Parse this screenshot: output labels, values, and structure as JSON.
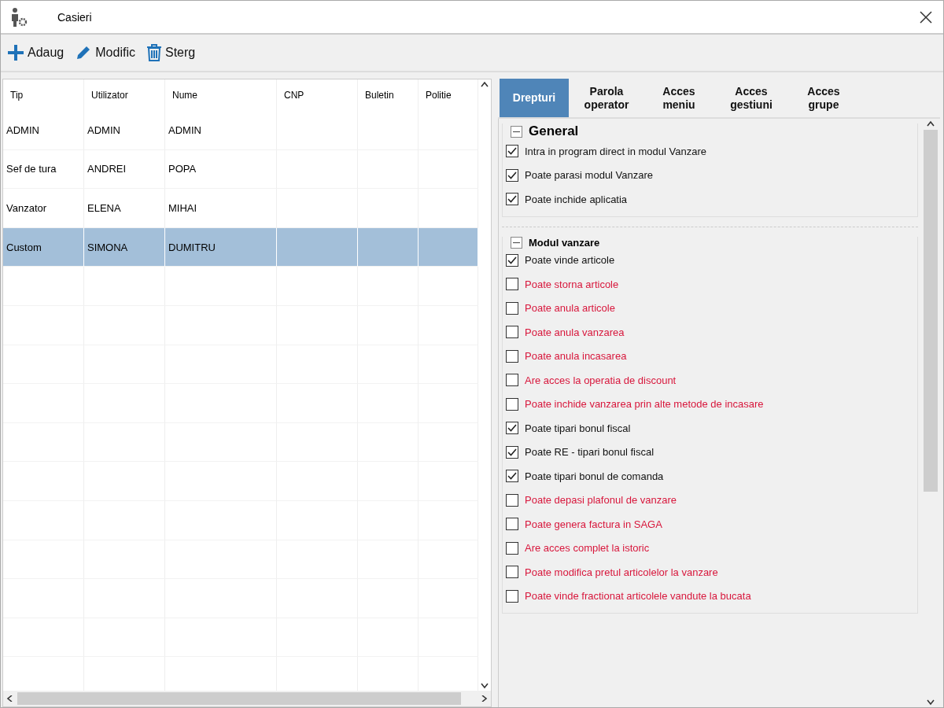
{
  "window": {
    "title": "Casieri"
  },
  "toolbar": [
    {
      "kind": "add",
      "label": "Adaug"
    },
    {
      "kind": "edit",
      "label": "Modific"
    },
    {
      "kind": "delete",
      "label": "Sterg"
    }
  ],
  "table": {
    "columns": [
      "Tip",
      "Utilizator",
      "Nume",
      "CNP",
      "Buletin",
      "Politie"
    ],
    "rows": [
      {
        "cells": [
          "ADMIN",
          "ADMIN",
          "ADMIN",
          "",
          "",
          ""
        ],
        "selected": false
      },
      {
        "cells": [
          "Sef de tura",
          "ANDREI",
          "POPA",
          "",
          "",
          ""
        ],
        "selected": false
      },
      {
        "cells": [
          "Vanzator",
          "ELENA",
          "MIHAI",
          "",
          "",
          ""
        ],
        "selected": false
      },
      {
        "cells": [
          "Custom",
          "SIMONA",
          "DUMITRU",
          "",
          "",
          ""
        ],
        "selected": true
      }
    ]
  },
  "tabs": [
    {
      "label": "Drepturi",
      "selected": true
    },
    {
      "label": "Parola operator",
      "selected": false
    },
    {
      "label": "Acces meniu",
      "selected": false
    },
    {
      "label": "Acces gestiuni",
      "selected": false
    },
    {
      "label": "Acces grupe",
      "selected": false
    }
  ],
  "sections": [
    {
      "title": "General",
      "large": true,
      "expanded": true,
      "items": [
        {
          "label": "Intra in program direct in modul Vanzare",
          "checked": true
        },
        {
          "label": "Poate parasi modul Vanzare",
          "checked": true
        },
        {
          "label": "Poate inchide aplicatia",
          "checked": true
        }
      ]
    },
    {
      "title": "Modul vanzare",
      "large": false,
      "expanded": true,
      "items": [
        {
          "label": "Poate vinde articole",
          "checked": true
        },
        {
          "label": "Poate storna articole",
          "checked": false
        },
        {
          "label": "Poate anula articole",
          "checked": false
        },
        {
          "label": "Poate anula vanzarea",
          "checked": false
        },
        {
          "label": "Poate anula incasarea",
          "checked": false
        },
        {
          "label": "Are acces la operatia de discount",
          "checked": false
        },
        {
          "label": "Poate inchide vanzarea prin alte metode de incasare",
          "checked": false
        },
        {
          "label": "Poate tipari bonul fiscal",
          "checked": true
        },
        {
          "label": "Poate RE - tipari bonul fiscal",
          "checked": true
        },
        {
          "label": "Poate tipari bonul de comanda",
          "checked": true
        },
        {
          "label": "Poate depasi plafonul de vanzare",
          "checked": false
        },
        {
          "label": "Poate genera factura in SAGA",
          "checked": false
        },
        {
          "label": "Are acces complet la istoric",
          "checked": false
        },
        {
          "label": "Poate modifica pretul articolelor la vanzare",
          "checked": false
        },
        {
          "label": "Poate vinde fractionat articolele vandute la bucata",
          "checked": false
        }
      ]
    }
  ]
}
